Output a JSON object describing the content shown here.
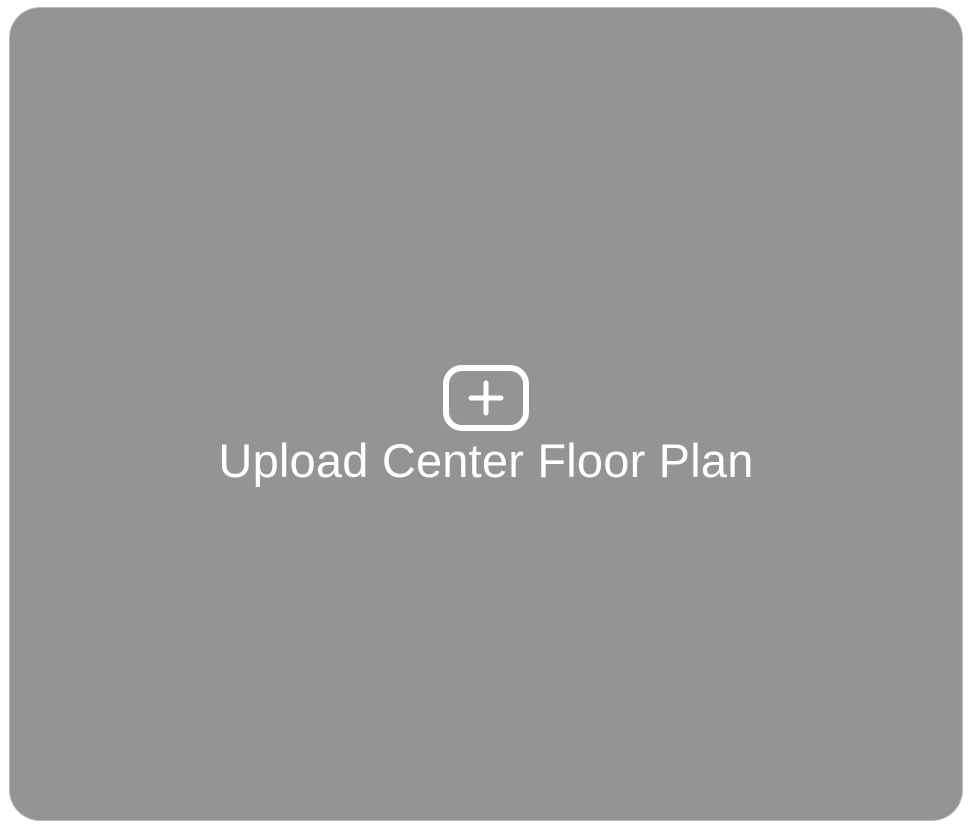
{
  "upload": {
    "label": "Upload Center Floor Plan",
    "icon": "plus-square-icon"
  },
  "colors": {
    "card_background": "#959492",
    "foreground": "#ffffff"
  }
}
